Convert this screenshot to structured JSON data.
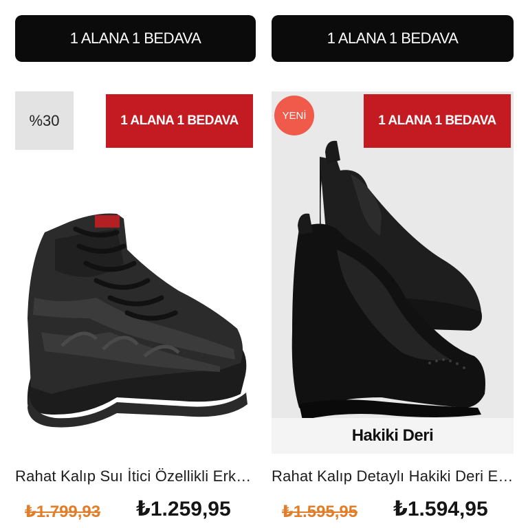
{
  "campaign_buttons": [
    {
      "label": "1 ALANA 1 BEDAVA"
    },
    {
      "label": "1 ALANA 1 BEDAVA"
    }
  ],
  "products": [
    {
      "discount_badge": "%30",
      "promo_badge": "1 ALANA 1 BEDAVA",
      "title": "Rahat Kalıp Suı İtici Özellikli Erkek Bot",
      "old_price": "₺1.799,93",
      "price": "₺1.259,95",
      "image_icon": "hiking-boot-image",
      "accent_color": "#c41b22"
    },
    {
      "new_badge": "YENİ",
      "promo_badge": "1 ALANA 1 BEDAVA",
      "feature_label": "Hakiki Deri",
      "title": "Rahat Kalıp Detaylı Hakiki Deri Erkek Bot",
      "old_price": "₺1.595,95",
      "price": "₺1.594,95",
      "image_icon": "chelsea-boot-image",
      "accent_color": "#ef5a4b"
    }
  ]
}
